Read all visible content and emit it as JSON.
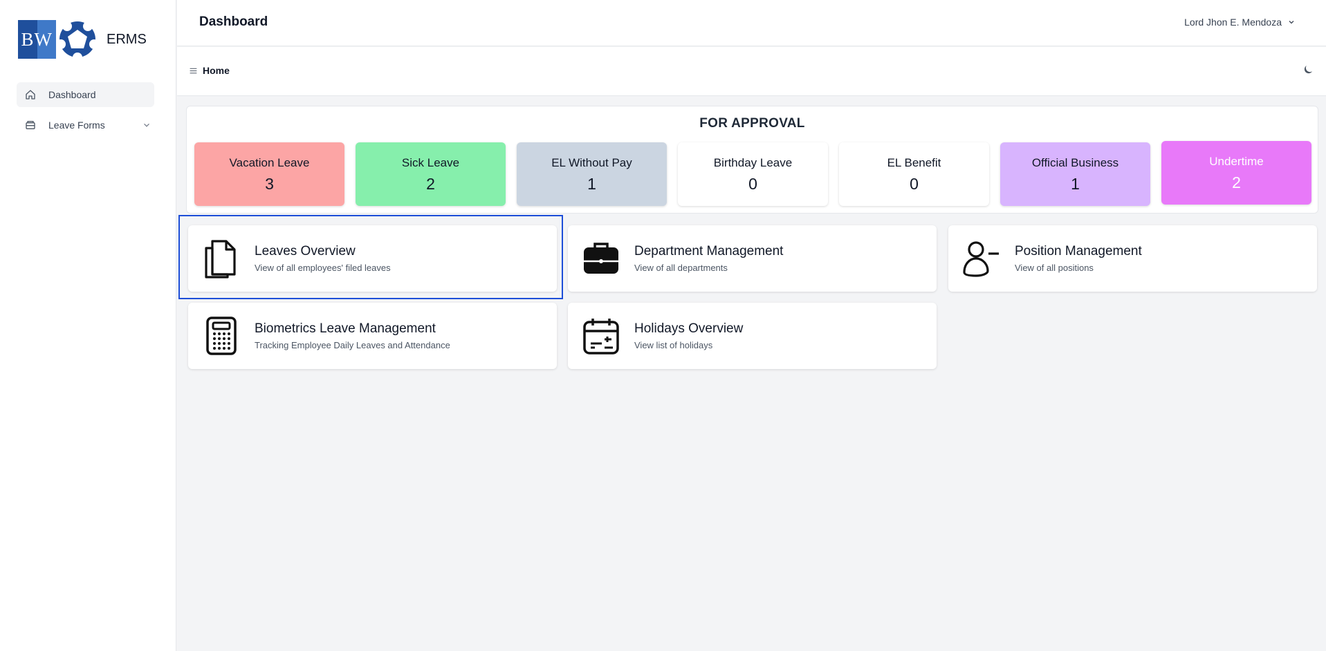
{
  "brand": {
    "logo_text": "BW",
    "name": "ERMS"
  },
  "sidebar": {
    "items": [
      {
        "label": "Dashboard",
        "icon": "home-icon",
        "active": true
      },
      {
        "label": "Leave Forms",
        "icon": "tray-icon",
        "has_submenu": true
      }
    ]
  },
  "header": {
    "title": "Dashboard",
    "user_name": "Lord Jhon E. Mendoza"
  },
  "breadcrumb": {
    "label": "Home"
  },
  "approval": {
    "title": "FOR APPROVAL",
    "cards": [
      {
        "label": "Vacation Leave",
        "value": "3",
        "color": "#fca5a5"
      },
      {
        "label": "Sick Leave",
        "value": "2",
        "color": "#86efac"
      },
      {
        "label": "EL Without Pay",
        "value": "1",
        "color": "#cbd5e1"
      },
      {
        "label": "Birthday Leave",
        "value": "0",
        "color": "#ffffff"
      },
      {
        "label": "EL Benefit",
        "value": "0",
        "color": "#ffffff"
      },
      {
        "label": "Official Business",
        "value": "1",
        "color": "#d8b4fe"
      },
      {
        "label": "Undertime",
        "value": "2",
        "color": "#e879f9"
      }
    ]
  },
  "modules": [
    {
      "title": "Leaves Overview",
      "subtitle": "View of all employees' filed leaves",
      "icon": "documents-icon",
      "selected": true
    },
    {
      "title": "Department Management",
      "subtitle": "View of all departments",
      "icon": "briefcase-icon"
    },
    {
      "title": "Position Management",
      "subtitle": "View of all positions",
      "icon": "user-minus-icon"
    },
    {
      "title": "Biometrics Leave Management",
      "subtitle": "Tracking Employee Daily Leaves and Attendance",
      "icon": "calculator-icon"
    },
    {
      "title": "Holidays Overview",
      "subtitle": "View list of holidays",
      "icon": "calendar-icon"
    }
  ],
  "colors": {
    "accent": "#1d4ed8",
    "undertime_text": "#ffffff"
  }
}
